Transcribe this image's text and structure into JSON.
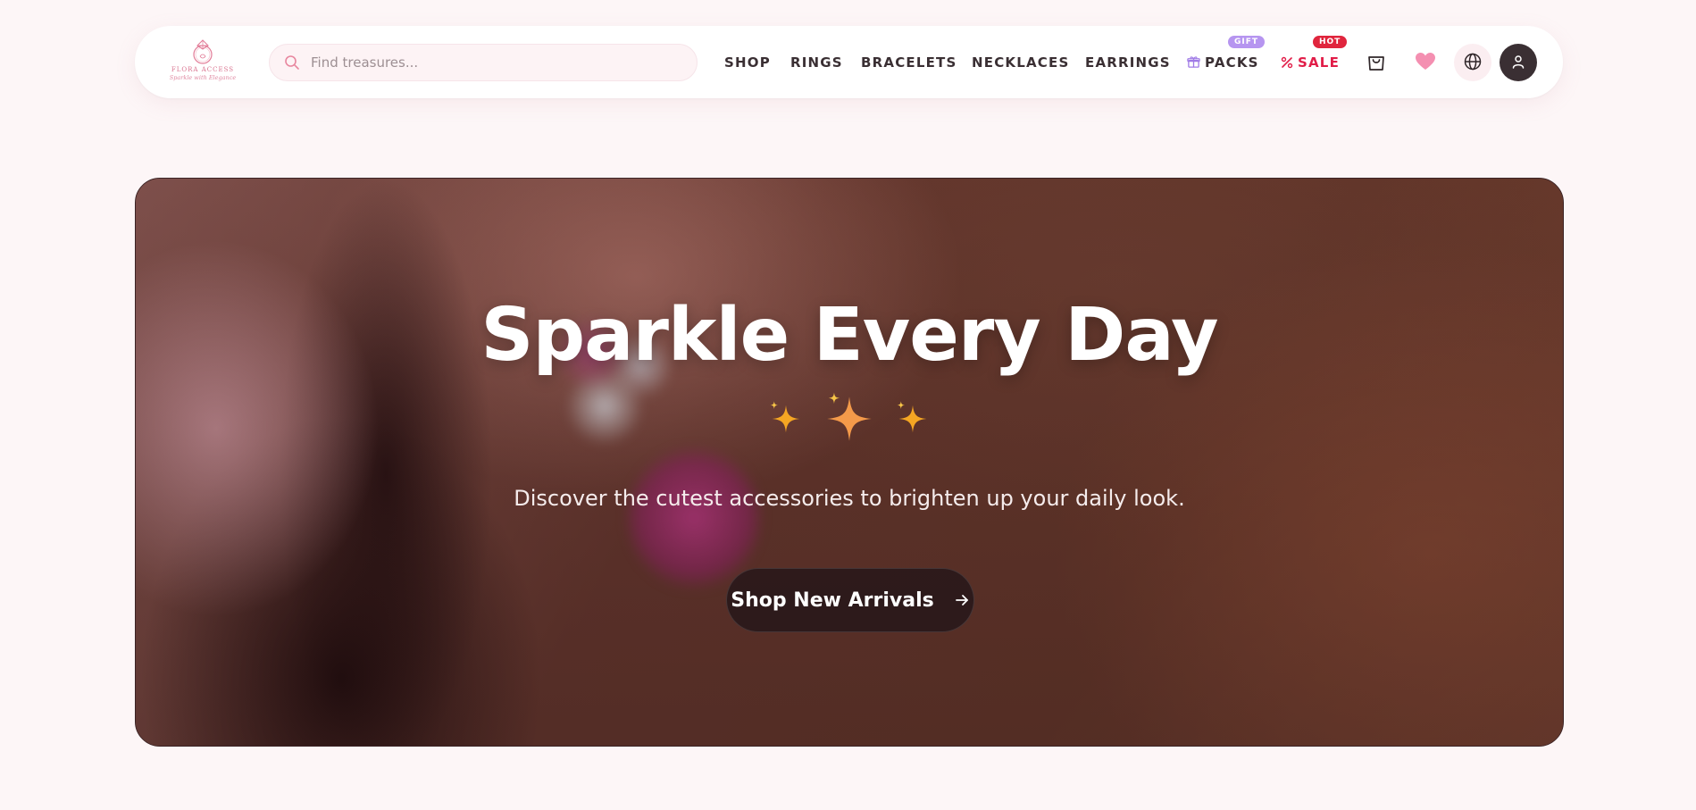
{
  "brand": {
    "name": "FLORA ACCESS",
    "tagline": "Sparkle with Elegance"
  },
  "search": {
    "placeholder": "Find treasures...",
    "icon": "search-icon"
  },
  "nav": {
    "items": [
      {
        "label": "SHOP"
      },
      {
        "label": "RINGS"
      },
      {
        "label": "BRACELETS"
      },
      {
        "label": "NECKLACES"
      },
      {
        "label": "EARRINGS"
      },
      {
        "label": "PACKS",
        "icon": "gift-icon",
        "badge": "GIFT"
      },
      {
        "label": "SALE",
        "icon": "percent-icon",
        "badge": "HOT"
      }
    ]
  },
  "actions": {
    "cart_icon": "shopping-bag-icon",
    "wishlist_icon": "heart-icon",
    "language_icon": "globe-icon",
    "account_icon": "user-icon"
  },
  "hero": {
    "title": "Sparkle Every Day",
    "sparkles": "✨ ✨ ✨",
    "subtitle": "Discover the cutest accessories to brighten up your daily look.",
    "cta_label": "Shop New Arrivals",
    "cta_icon": "arrow-right-icon"
  },
  "colors": {
    "page_bg": "#fdf6f7",
    "accent_pink": "#f48fb1",
    "sale_red": "#e11d48",
    "gift_purple": "#b695f0",
    "dark": "#3a2f33"
  }
}
